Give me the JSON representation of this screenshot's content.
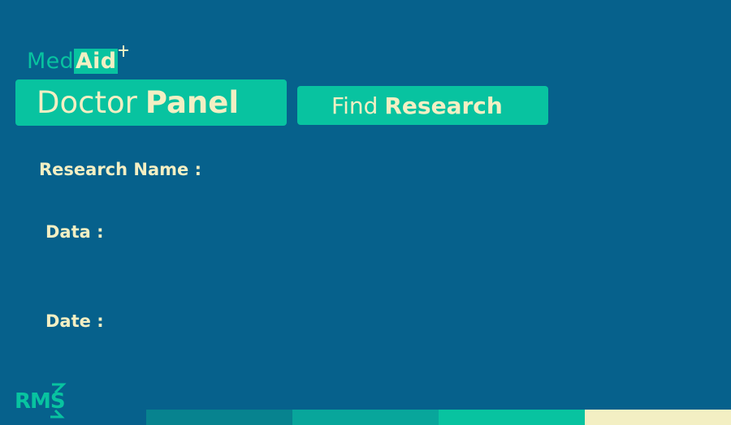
{
  "logo": {
    "med": "Med",
    "aid": "Aid"
  },
  "header": {
    "panel": {
      "word1": "Doctor",
      "word2": "Panel"
    },
    "find_button": {
      "word1": "Find",
      "word2": "Research"
    }
  },
  "fields": {
    "research_name_label": "Research Name :",
    "data_label": "Data :",
    "date_label": "Date :"
  },
  "footer_logo": "RMS",
  "colors": {
    "background": "#06618C",
    "accent": "#08C3A0",
    "text": "#F3EFC3",
    "bar_1": "#07838F",
    "bar_2": "#08A69B",
    "bar_3": "#08C3A0",
    "bar_4": "#F3EFC3"
  }
}
